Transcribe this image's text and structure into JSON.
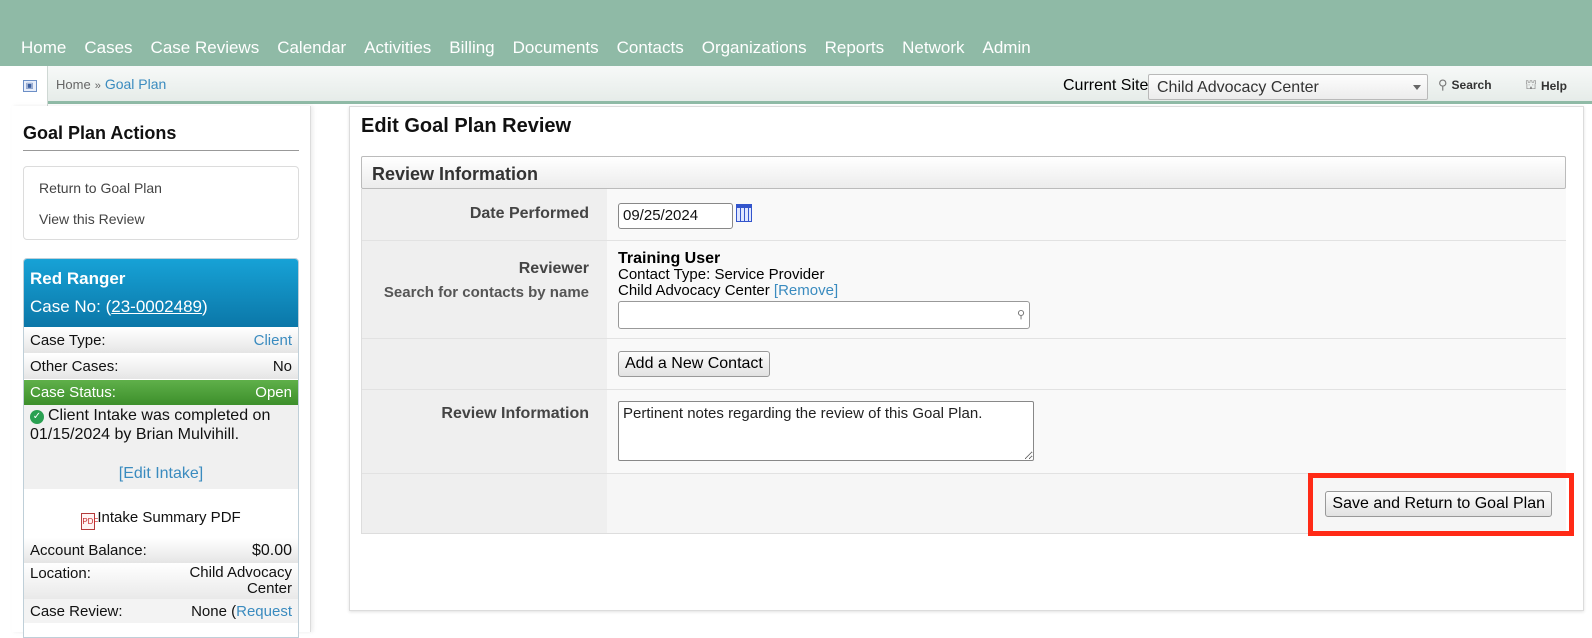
{
  "nav": {
    "items": [
      "Home",
      "Cases",
      "Case Reviews",
      "Calendar",
      "Activities",
      "Billing",
      "Documents",
      "Contacts",
      "Organizations",
      "Reports",
      "Network",
      "Admin"
    ]
  },
  "breadcrumb": {
    "home": "Home",
    "separator": "»",
    "current": "Goal Plan"
  },
  "site": {
    "label": "Current Site",
    "selected": "Child Advocacy Center"
  },
  "toolbar": {
    "search_label": "Search",
    "help_label": "Help"
  },
  "sidebar": {
    "title": "Goal Plan Actions",
    "actions": [
      "Return to Goal Plan",
      "View this Review"
    ]
  },
  "case": {
    "name": "Red Ranger",
    "case_no_prefix": "Case No: (",
    "case_no": "23-0002489",
    "case_no_suffix": ")",
    "type_label": "Case Type:",
    "type_value": "Client",
    "other_label": "Other Cases:",
    "other_value": "No",
    "status_label": "Case Status:",
    "status_value": "Open",
    "intake_text": "Client Intake was completed on 01/15/2024 by Brian Mulvihill.",
    "edit_intake": "[Edit Intake]",
    "pdf_label": "Intake Summary PDF",
    "balance_label": "Account Balance:",
    "balance_value": "$0.00",
    "location_label": "Location:",
    "location_value": "Child Advocacy Center",
    "review_label": "Case Review:",
    "review_value": "None (",
    "review_link": "Request"
  },
  "form": {
    "title": "Edit Goal Plan Review",
    "section": "Review Information",
    "date_label": "Date Performed",
    "date_value": "09/25/2024",
    "reviewer_label": "Reviewer",
    "reviewer_search_label": "Search for contacts by name",
    "reviewer_name": "Training User",
    "reviewer_type": "Contact Type: Service Provider",
    "reviewer_org": "Child Advocacy Center",
    "remove_label": "[Remove]",
    "add_contact_label": "Add a New Contact",
    "review_info_label": "Review Information",
    "review_info_value": "Pertinent notes regarding the review of this Goal Plan.",
    "save_label": "Save and Return to Goal Plan"
  }
}
